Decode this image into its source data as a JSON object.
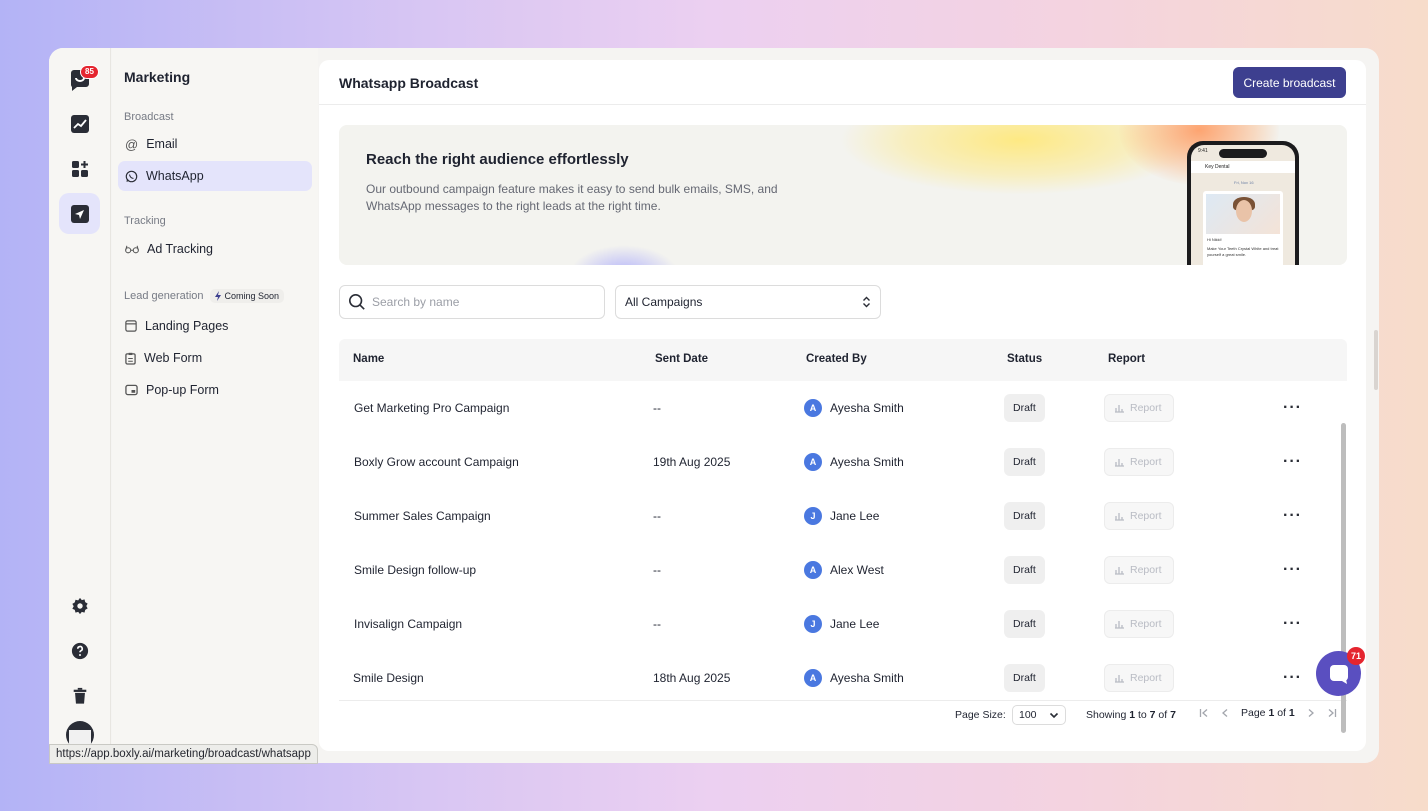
{
  "rail": {
    "logo_badge": "85",
    "items": [
      "analytics-icon",
      "apps-add-icon",
      "send-icon"
    ],
    "bottom": [
      "gear-icon",
      "help-icon",
      "trash-icon"
    ]
  },
  "subnav": {
    "title": "Marketing",
    "broadcast_section": "Broadcast",
    "email": "Email",
    "whatsapp": "WhatsApp",
    "tracking_section": "Tracking",
    "ad_tracking": "Ad Tracking",
    "lead_section": "Lead generation",
    "coming_soon": "Coming Soon",
    "landing_pages": "Landing Pages",
    "web_form": "Web Form",
    "popup_form": "Pop-up Form"
  },
  "header": {
    "title": "Whatsapp Broadcast",
    "create_label": "Create broadcast"
  },
  "banner": {
    "title": "Reach the right audience effortlessly",
    "text": "Our outbound campaign feature makes it easy to send bulk emails, SMS, and WhatsApp messages to the right leads at the right time.",
    "phone": {
      "time": "9:41",
      "chat_name": "Key Dental",
      "date": "Fri, Nov 16",
      "greeting": "Hi Nikki!",
      "message": "Make Your Teeth Crystal White and treat yourself a great smile."
    }
  },
  "filters": {
    "search_placeholder": "Search by name",
    "campaign_filter": "All Campaigns"
  },
  "table": {
    "columns": [
      "Name",
      "Sent Date",
      "Created By",
      "Status",
      "Report"
    ],
    "report_label": "Report",
    "rows": [
      {
        "name": "Get Marketing Pro Campaign",
        "sent": "--",
        "initial": "A",
        "creator": "Ayesha Smith",
        "status": "Draft"
      },
      {
        "name": "Boxly Grow account Campaign",
        "sent": "19th Aug 2025",
        "initial": "A",
        "creator": "Ayesha Smith",
        "status": "Draft"
      },
      {
        "name": "Summer Sales Campaign",
        "sent": "--",
        "initial": "J",
        "creator": "Jane Lee",
        "status": "Draft"
      },
      {
        "name": "Smile Design follow-up",
        "sent": "--",
        "initial": "A",
        "creator": "Alex West",
        "status": "Draft"
      },
      {
        "name": "Invisalign Campaign",
        "sent": "--",
        "initial": "J",
        "creator": "Jane Lee",
        "status": "Draft"
      },
      {
        "name": "Smile Design",
        "sent": "18th Aug 2025",
        "initial": "A",
        "creator": "Ayesha Smith",
        "status": "Draft"
      }
    ]
  },
  "pagination": {
    "page_size_label": "Page Size:",
    "page_size": "100",
    "showing_prefix": "Showing",
    "from": "1",
    "to_word": "to",
    "to": "7",
    "of_word": "of",
    "total": "7",
    "page_word": "Page",
    "page": "1",
    "pages": "1"
  },
  "statusbar": {
    "url": "https://app.boxly.ai/marketing/broadcast/whatsapp"
  },
  "chat": {
    "badge": "71"
  },
  "colors": {
    "accent": "#3d3f8f",
    "active_nav": "#e4e4fb",
    "avatar": "#4a78e0",
    "badge": "#e5252f"
  }
}
